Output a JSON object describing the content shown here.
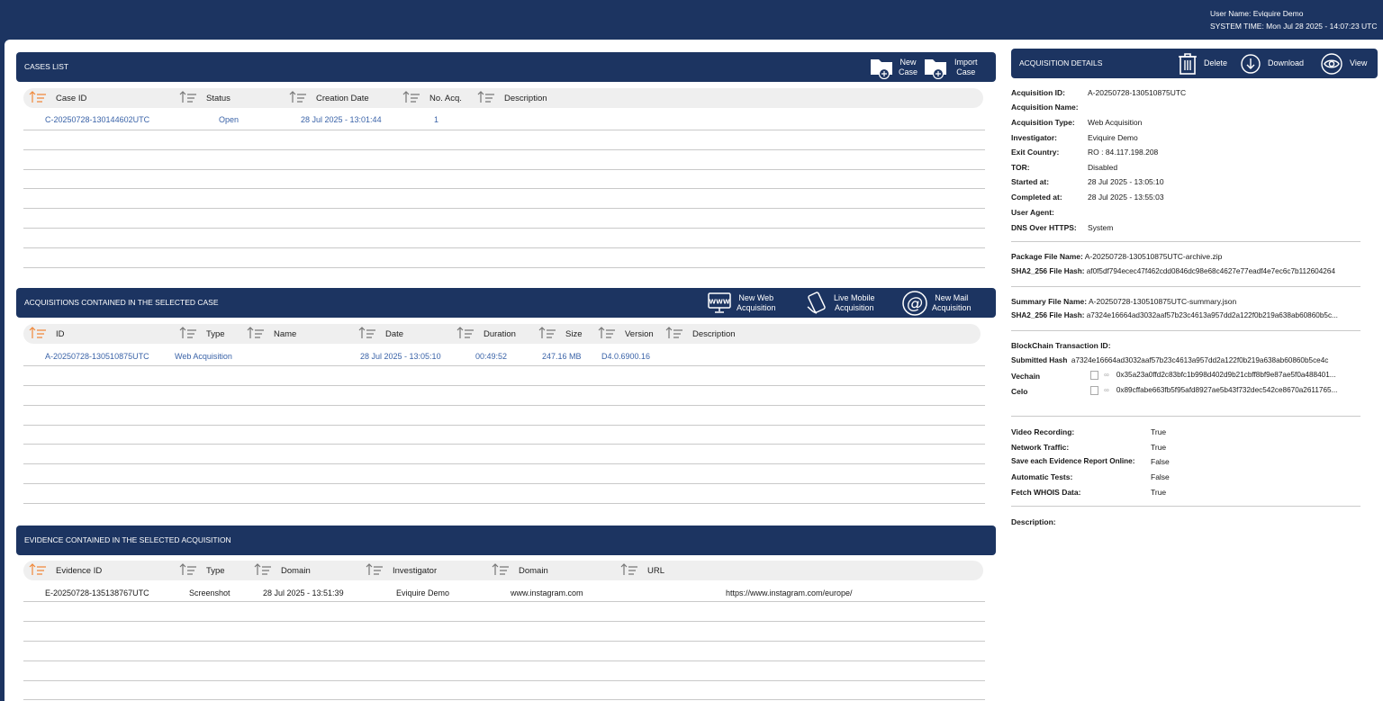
{
  "topbar": {
    "user_name": "User Name:  Eviquire Demo",
    "system_time": "SYSTEM TIME:  Mon Jul 28 2025 - 14:07:23 UTC"
  },
  "cases": {
    "title": "CASES LIST",
    "new_case": [
      "New",
      "Case"
    ],
    "import_case": [
      "Import",
      "Case"
    ],
    "columns": [
      "Case ID",
      "Status",
      "Creation Date",
      "No. Acq.",
      "Description"
    ],
    "rows": [
      {
        "id": "C-20250728-130144602UTC",
        "status": "Open",
        "date": "28 Jul 2025 - 13:01:44",
        "count": "1",
        "description": ""
      }
    ]
  },
  "acquisitions": {
    "title": "ACQUISITIONS CONTAINED IN THE SELECTED CASE",
    "new_web": [
      "New Web",
      "Acquisition"
    ],
    "live_mobile": [
      "Live Mobile",
      "Acquisition"
    ],
    "new_mail": [
      "New Mail",
      "Acquisition"
    ],
    "columns": [
      "ID",
      "Type",
      "Name",
      "Date",
      "Duration",
      "Size",
      "Version",
      "Description"
    ],
    "rows": [
      {
        "id": "A-20250728-130510875UTC",
        "type": "Web Acquisition",
        "name": "",
        "date": "28 Jul 2025 - 13:05:10",
        "duration": "00:49:52",
        "size": "247.16 MB",
        "version": "D4.0.6900.16",
        "description": ""
      }
    ]
  },
  "evidence": {
    "title": "EVIDENCE CONTAINED IN THE SELECTED ACQUISITION",
    "columns": [
      "Evidence ID",
      "Type",
      "Domain",
      "Investigator",
      "Domain",
      "URL"
    ],
    "rows": [
      {
        "id": "E-20250728-135138767UTC",
        "type": "Screenshot",
        "date": "28 Jul 2025 - 13:51:39",
        "investigator": "Eviquire Demo",
        "domain": "www.instagram.com",
        "url": "https://www.instagram.com/europe/"
      }
    ]
  },
  "details": {
    "title": "ACQUISITION DETAILS",
    "delete": "Delete",
    "download": "Download",
    "view": "View",
    "fields": [
      {
        "label": "Acquisition ID:",
        "value": "A-20250728-130510875UTC"
      },
      {
        "label": "Acquisition Name:",
        "value": ""
      },
      {
        "label": "Acquisition Type:",
        "value": "Web Acquisition"
      },
      {
        "label": "Investigator:",
        "value": "Eviquire Demo"
      },
      {
        "label": "Exit Country:",
        "value": "RO : 84.117.198.208"
      },
      {
        "label": "TOR:",
        "value": "Disabled"
      },
      {
        "label": "Started at:",
        "value": "28 Jul 2025 - 13:05:10"
      },
      {
        "label": "Completed at:",
        "value": "28 Jul 2025 - 13:55:03"
      },
      {
        "label": "User Agent:",
        "value": ""
      },
      {
        "label": "DNS Over HTTPS:",
        "value": "System"
      }
    ],
    "package_name_label": "Package File Name:",
    "package_name": "A-20250728-130510875UTC-archive.zip",
    "package_hash_label": "SHA2_256 File Hash:",
    "package_hash": "af0f5df794ecec47f462cdd0846dc98e68c4627e77eadf4e7ec6c7b112604264",
    "summary_name_label": "Summary File Name:",
    "summary_name": "A-20250728-130510875UTC-summary.json",
    "summary_hash_label": "SHA2_256 File Hash:",
    "summary_hash": "a7324e16664ad3032aaf57b23c4613a957dd2a122f0b219a638ab60860b5c...",
    "blockchain_label": "BlockChain Transaction ID:",
    "submitted_label": "Submitted Hash",
    "submitted_hash": "a7324e16664ad3032aaf57b23c4613a957dd2a122f0b219a638ab60860b5ce4c",
    "vechain_label": "Vechain",
    "vechain_tx": "0x35a23a0ffd2c83bfc1b998d402d9b21cbff8bf9e87ae5f0a488401...",
    "celo_label": "Celo",
    "celo_tx": "0x89cffabe663fb5f95afd8927ae5b43f732dec542ce8670a2611765...",
    "flags": [
      {
        "label": "Video Recording:",
        "value": "True"
      },
      {
        "label": "Network Traffic:",
        "value": "True"
      },
      {
        "label": "Save each Evidence Report Online:",
        "value": "False"
      },
      {
        "label": "Automatic Tests:",
        "value": "False"
      },
      {
        "label": "Fetch WHOIS Data:",
        "value": "True"
      }
    ],
    "description_label": "Description:"
  },
  "colors": {
    "navy": "#1c3461",
    "accent": "#f0883a",
    "link": "#3a63a8"
  }
}
